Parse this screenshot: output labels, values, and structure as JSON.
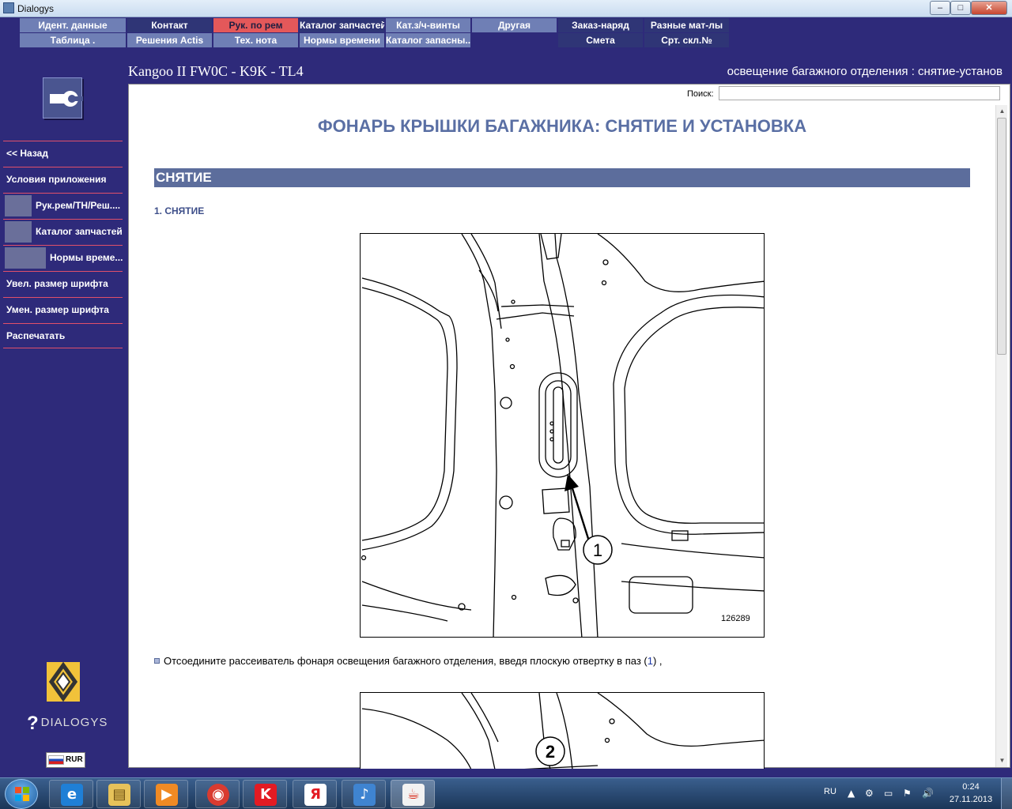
{
  "window": {
    "title": "Dialogys",
    "min_label": "–",
    "max_label": "□",
    "close_label": "✕"
  },
  "menu": {
    "row1": [
      "Идент. данные",
      "Контакт",
      "Рук. по рем",
      "Каталог запчастей",
      "Кат.з/ч-винты",
      "Другая",
      "Заказ-наряд",
      "Разные мат-лы"
    ],
    "row2": [
      "Таблица .",
      "Решения Actis",
      "Тех. нота",
      "Нормы времени",
      "Каталог запасны...",
      "Смета",
      "Срт. скл.№"
    ]
  },
  "header": {
    "car": "Kangoo II FW0C - K9K - TL4",
    "operation": "освещение багажного отделения : снятие-установ"
  },
  "sidebar": {
    "items": [
      "<< Назад",
      "Условия приложения",
      "Рук.рем/ТН/Реш....",
      "Каталог запчастей",
      "Нормы време...",
      "Увел. размер шрифта",
      "Умен. размер шрифта",
      "Распечатать"
    ],
    "brand": "DIALOGYS",
    "brand_q": "?",
    "lang": "RUR"
  },
  "search": {
    "label": "Поиск:",
    "value": ""
  },
  "document": {
    "title": "ФОНАРЬ КРЫШКИ БАГАЖНИКА: СНЯТИЕ И УСТАНОВКА",
    "section": "СНЯТИЕ",
    "subsection": "1. СНЯТИЕ",
    "figure1_number": "126289",
    "figure1_callout": "1",
    "figure2_callout": "2",
    "instruction_before": "Отсоедините рассеиватель фонаря освещения багажного отделения, введя плоскую отвертку в паз (",
    "instruction_ref": "1",
    "instruction_after": ") ,"
  },
  "taskbar": {
    "apps": [
      "ie-icon",
      "explorer-icon",
      "media-player-icon",
      "chrome-icon",
      "kaspersky-icon",
      "yandex-icon",
      "volume-app-icon",
      "java-icon"
    ],
    "app_glyphs": [
      "e",
      "▤",
      "▶",
      "◉",
      "K",
      "Я",
      "♪",
      "☕"
    ],
    "lang": "RU",
    "tray_glyphs": [
      "▲",
      "⚙",
      "▭",
      "⚑",
      "🔊"
    ],
    "time": "0:24",
    "date": "27.11.2013"
  },
  "colors": {
    "sidebar_bg": "#2e2a7a",
    "menu_gray": "#6f7fb5",
    "menu_dark": "#2f3576",
    "menu_active": "#e4585a",
    "doc_title": "#5a6fa4",
    "section_bar": "#5c6d9c"
  }
}
